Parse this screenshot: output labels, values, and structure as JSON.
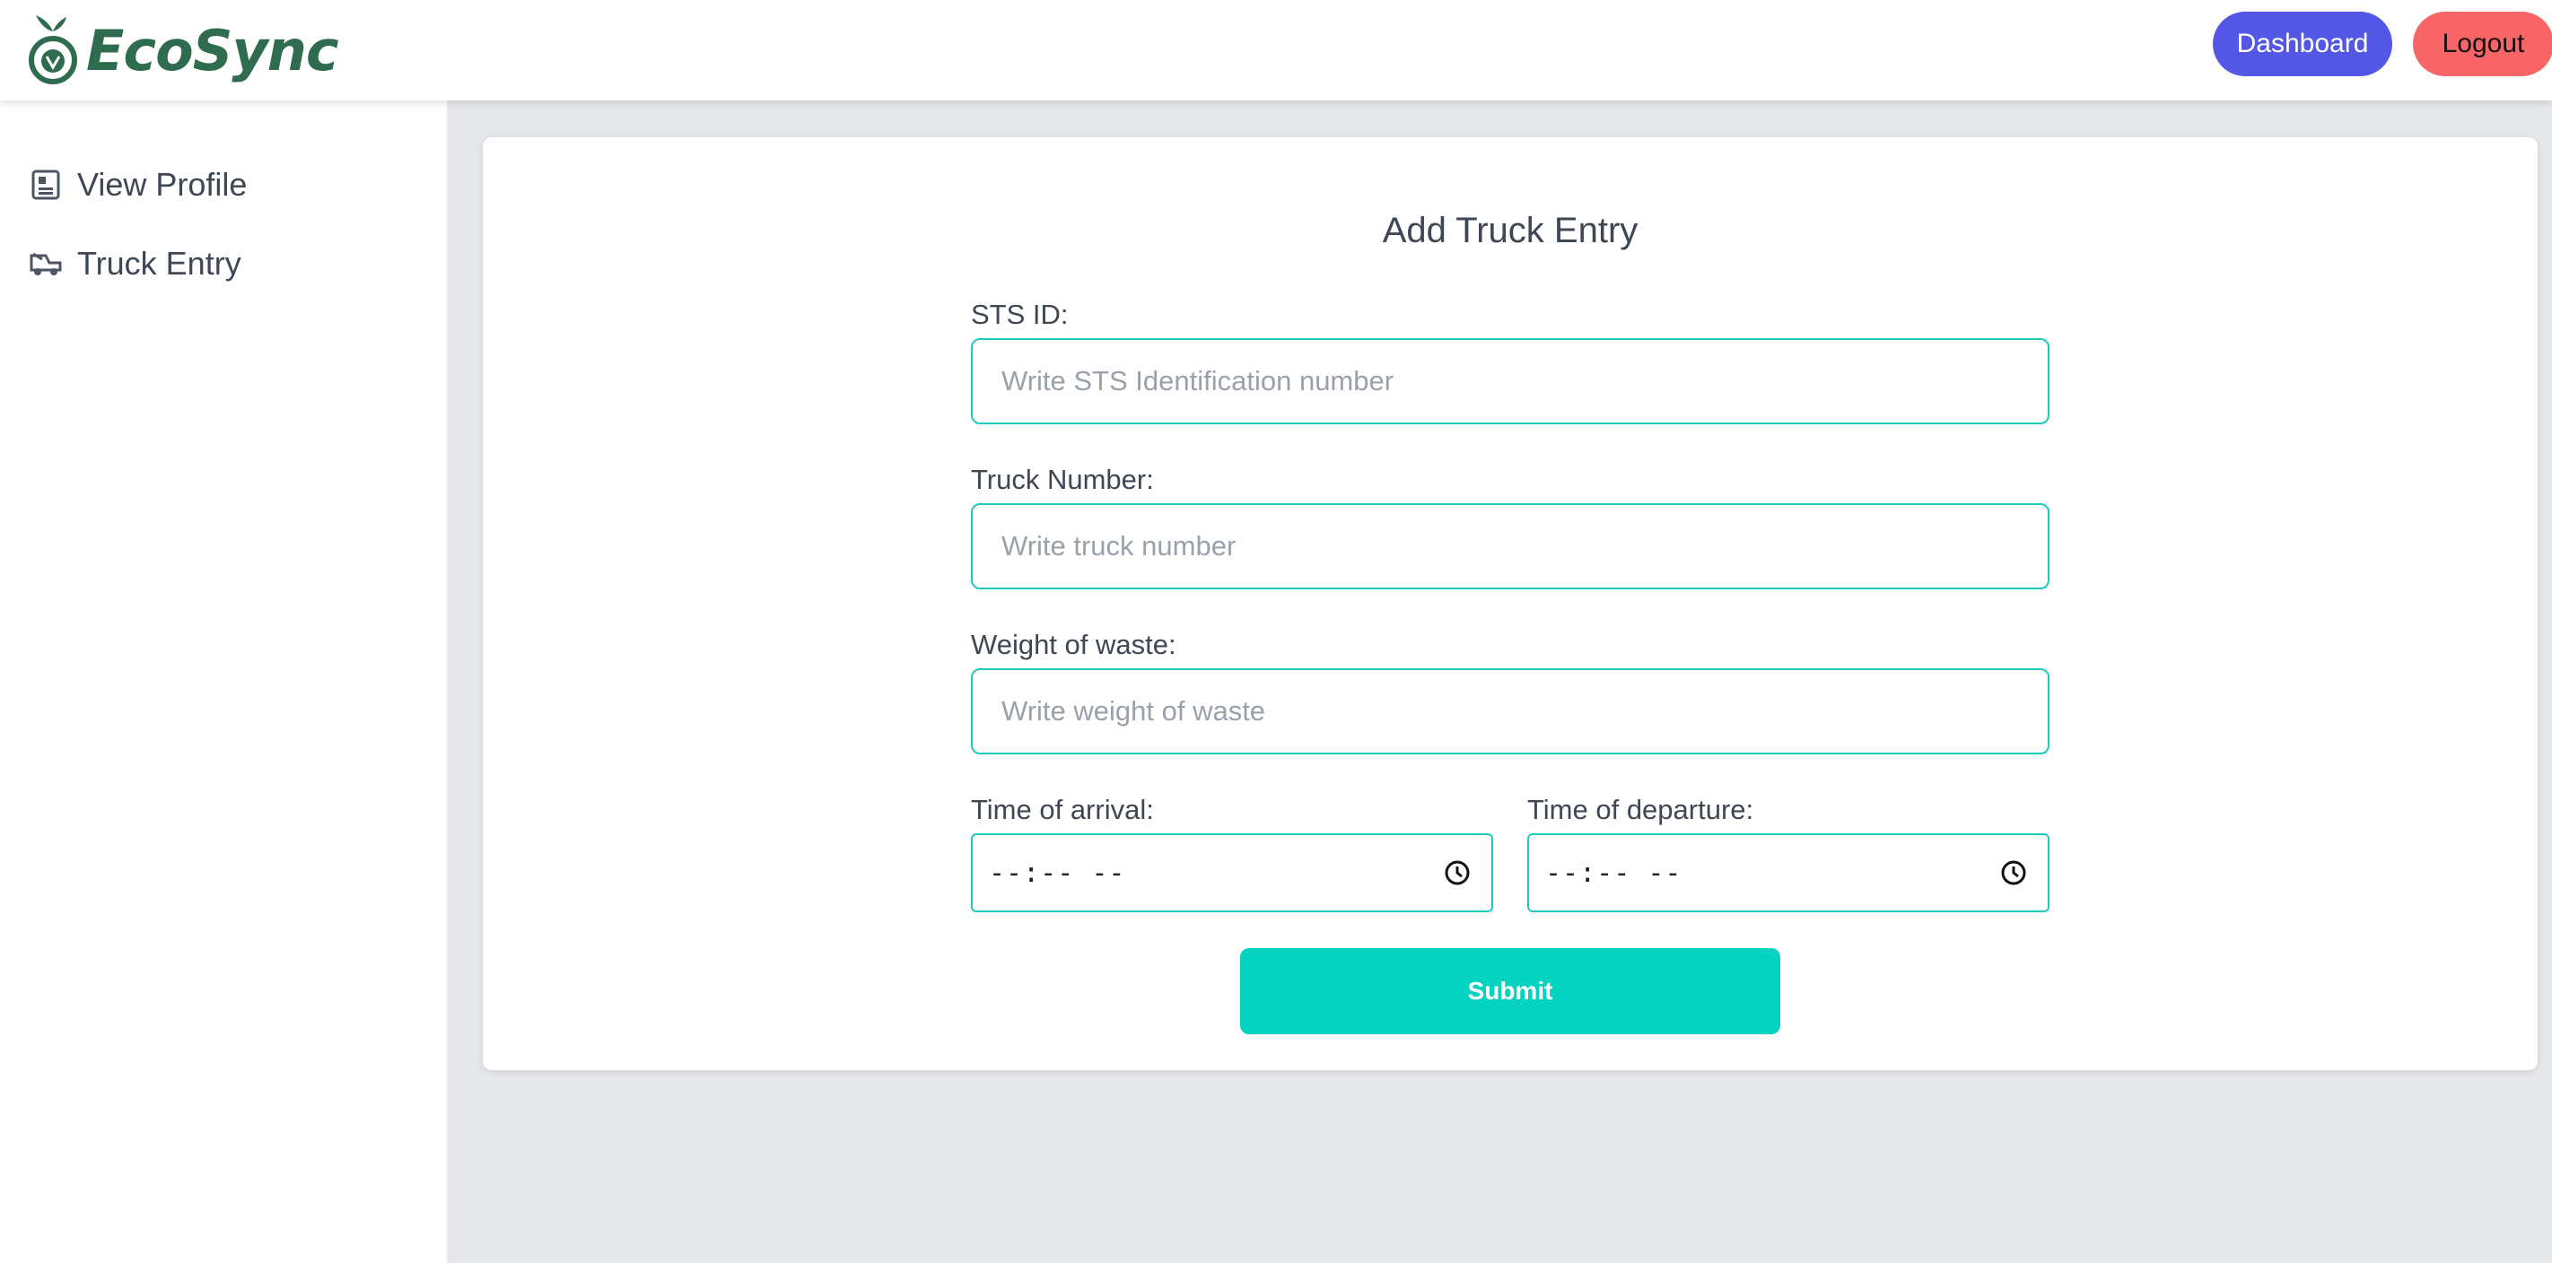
{
  "header": {
    "brand": "EcoSync",
    "brand_icon": "leaf-apple-logo-icon",
    "dashboard_label": "Dashboard",
    "logout_label": "Logout",
    "colors": {
      "dashboard": "#5457e6",
      "logout": "#f86566",
      "brand": "#2f6b4f"
    }
  },
  "sidebar": {
    "items": [
      {
        "label": "View Profile",
        "icon": "profile-card-icon"
      },
      {
        "label": "Truck Entry",
        "icon": "truck-icon"
      }
    ]
  },
  "form": {
    "title": "Add Truck Entry",
    "sts_id": {
      "label": "STS ID:",
      "placeholder": "Write STS Identification number",
      "value": ""
    },
    "truck_number": {
      "label": "Truck Number:",
      "placeholder": "Write truck number",
      "value": ""
    },
    "weight": {
      "label": "Weight of waste:",
      "placeholder": "Write weight of waste",
      "value": ""
    },
    "arrival": {
      "label": "Time of arrival:",
      "value": "--:-- --",
      "icon": "clock-icon"
    },
    "departure": {
      "label": "Time of departure:",
      "value": "--:-- --",
      "icon": "clock-icon"
    },
    "submit_label": "Submit",
    "accent_color": "#03d3c0"
  }
}
